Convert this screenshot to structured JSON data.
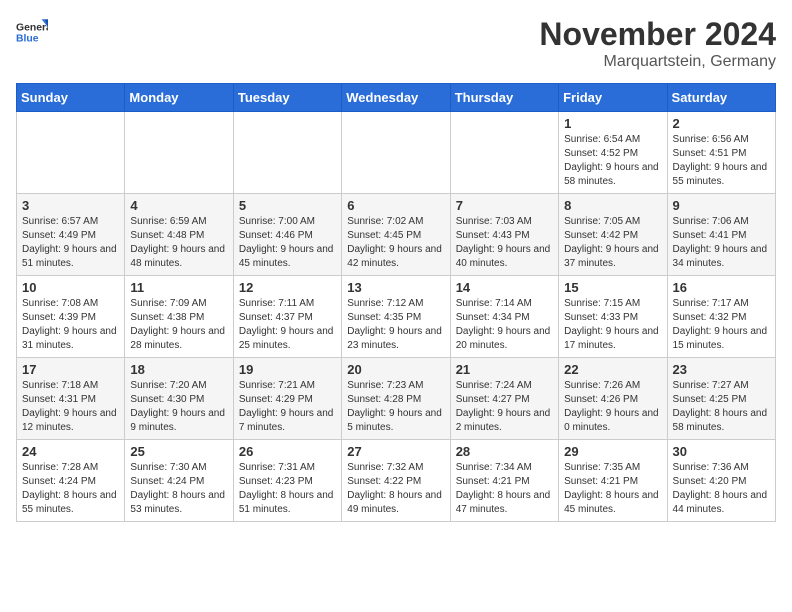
{
  "logo": {
    "general": "General",
    "blue": "Blue"
  },
  "title": "November 2024",
  "location": "Marquartstein, Germany",
  "days_of_week": [
    "Sunday",
    "Monday",
    "Tuesday",
    "Wednesday",
    "Thursday",
    "Friday",
    "Saturday"
  ],
  "weeks": [
    [
      {
        "day": "",
        "info": ""
      },
      {
        "day": "",
        "info": ""
      },
      {
        "day": "",
        "info": ""
      },
      {
        "day": "",
        "info": ""
      },
      {
        "day": "",
        "info": ""
      },
      {
        "day": "1",
        "info": "Sunrise: 6:54 AM\nSunset: 4:52 PM\nDaylight: 9 hours and 58 minutes."
      },
      {
        "day": "2",
        "info": "Sunrise: 6:56 AM\nSunset: 4:51 PM\nDaylight: 9 hours and 55 minutes."
      }
    ],
    [
      {
        "day": "3",
        "info": "Sunrise: 6:57 AM\nSunset: 4:49 PM\nDaylight: 9 hours and 51 minutes."
      },
      {
        "day": "4",
        "info": "Sunrise: 6:59 AM\nSunset: 4:48 PM\nDaylight: 9 hours and 48 minutes."
      },
      {
        "day": "5",
        "info": "Sunrise: 7:00 AM\nSunset: 4:46 PM\nDaylight: 9 hours and 45 minutes."
      },
      {
        "day": "6",
        "info": "Sunrise: 7:02 AM\nSunset: 4:45 PM\nDaylight: 9 hours and 42 minutes."
      },
      {
        "day": "7",
        "info": "Sunrise: 7:03 AM\nSunset: 4:43 PM\nDaylight: 9 hours and 40 minutes."
      },
      {
        "day": "8",
        "info": "Sunrise: 7:05 AM\nSunset: 4:42 PM\nDaylight: 9 hours and 37 minutes."
      },
      {
        "day": "9",
        "info": "Sunrise: 7:06 AM\nSunset: 4:41 PM\nDaylight: 9 hours and 34 minutes."
      }
    ],
    [
      {
        "day": "10",
        "info": "Sunrise: 7:08 AM\nSunset: 4:39 PM\nDaylight: 9 hours and 31 minutes."
      },
      {
        "day": "11",
        "info": "Sunrise: 7:09 AM\nSunset: 4:38 PM\nDaylight: 9 hours and 28 minutes."
      },
      {
        "day": "12",
        "info": "Sunrise: 7:11 AM\nSunset: 4:37 PM\nDaylight: 9 hours and 25 minutes."
      },
      {
        "day": "13",
        "info": "Sunrise: 7:12 AM\nSunset: 4:35 PM\nDaylight: 9 hours and 23 minutes."
      },
      {
        "day": "14",
        "info": "Sunrise: 7:14 AM\nSunset: 4:34 PM\nDaylight: 9 hours and 20 minutes."
      },
      {
        "day": "15",
        "info": "Sunrise: 7:15 AM\nSunset: 4:33 PM\nDaylight: 9 hours and 17 minutes."
      },
      {
        "day": "16",
        "info": "Sunrise: 7:17 AM\nSunset: 4:32 PM\nDaylight: 9 hours and 15 minutes."
      }
    ],
    [
      {
        "day": "17",
        "info": "Sunrise: 7:18 AM\nSunset: 4:31 PM\nDaylight: 9 hours and 12 minutes."
      },
      {
        "day": "18",
        "info": "Sunrise: 7:20 AM\nSunset: 4:30 PM\nDaylight: 9 hours and 9 minutes."
      },
      {
        "day": "19",
        "info": "Sunrise: 7:21 AM\nSunset: 4:29 PM\nDaylight: 9 hours and 7 minutes."
      },
      {
        "day": "20",
        "info": "Sunrise: 7:23 AM\nSunset: 4:28 PM\nDaylight: 9 hours and 5 minutes."
      },
      {
        "day": "21",
        "info": "Sunrise: 7:24 AM\nSunset: 4:27 PM\nDaylight: 9 hours and 2 minutes."
      },
      {
        "day": "22",
        "info": "Sunrise: 7:26 AM\nSunset: 4:26 PM\nDaylight: 9 hours and 0 minutes."
      },
      {
        "day": "23",
        "info": "Sunrise: 7:27 AM\nSunset: 4:25 PM\nDaylight: 8 hours and 58 minutes."
      }
    ],
    [
      {
        "day": "24",
        "info": "Sunrise: 7:28 AM\nSunset: 4:24 PM\nDaylight: 8 hours and 55 minutes."
      },
      {
        "day": "25",
        "info": "Sunrise: 7:30 AM\nSunset: 4:24 PM\nDaylight: 8 hours and 53 minutes."
      },
      {
        "day": "26",
        "info": "Sunrise: 7:31 AM\nSunset: 4:23 PM\nDaylight: 8 hours and 51 minutes."
      },
      {
        "day": "27",
        "info": "Sunrise: 7:32 AM\nSunset: 4:22 PM\nDaylight: 8 hours and 49 minutes."
      },
      {
        "day": "28",
        "info": "Sunrise: 7:34 AM\nSunset: 4:21 PM\nDaylight: 8 hours and 47 minutes."
      },
      {
        "day": "29",
        "info": "Sunrise: 7:35 AM\nSunset: 4:21 PM\nDaylight: 8 hours and 45 minutes."
      },
      {
        "day": "30",
        "info": "Sunrise: 7:36 AM\nSunset: 4:20 PM\nDaylight: 8 hours and 44 minutes."
      }
    ]
  ]
}
